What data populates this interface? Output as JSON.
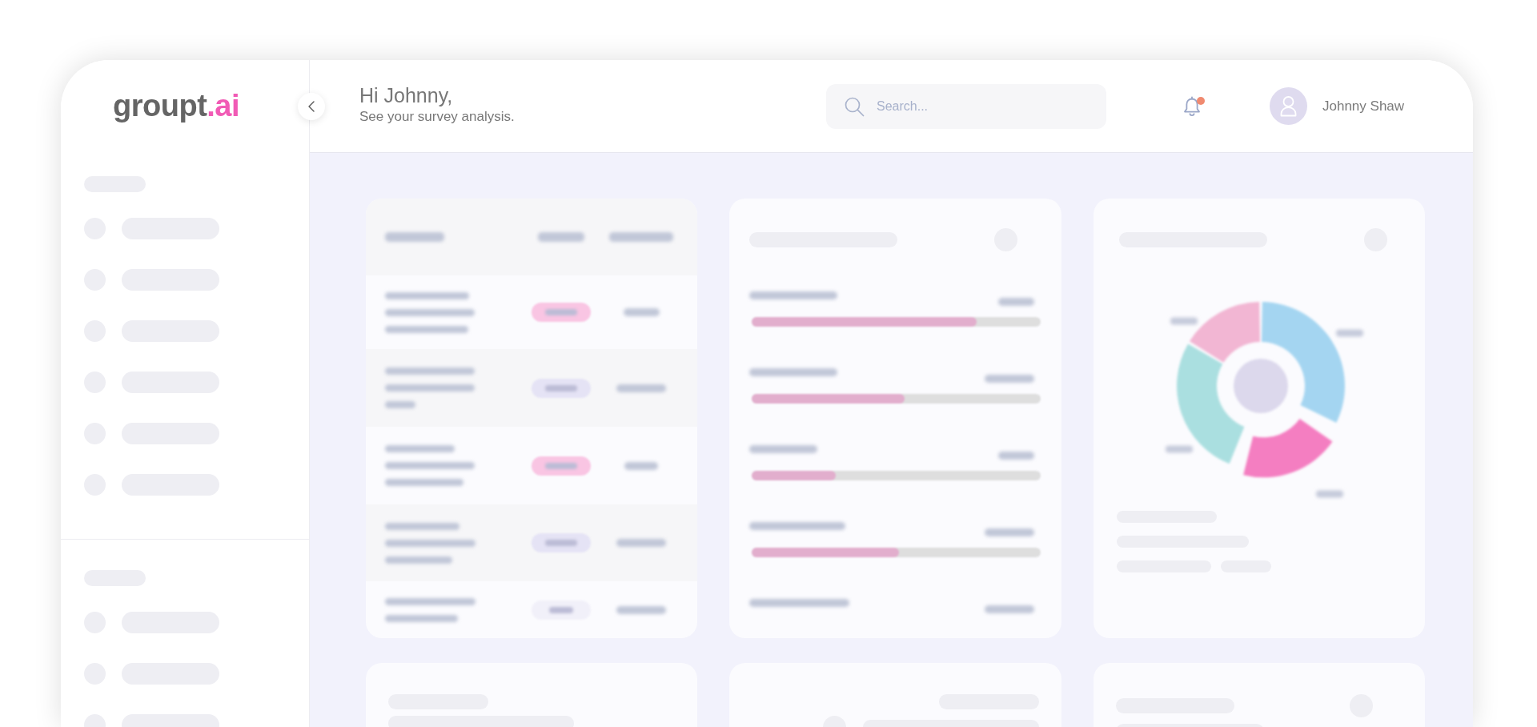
{
  "logo": {
    "name": "groupt",
    "accent": ".ai"
  },
  "header": {
    "greeting": "Hi Johnny,",
    "subtitle": "See your survey analysis.",
    "search": {
      "placeholder": "Search..."
    },
    "notifications": {
      "unread": true
    },
    "user": {
      "name": "Johnny Shaw"
    }
  },
  "sidebar": {
    "sections": [
      {
        "heading": {
          "kind": "placeholder"
        },
        "items": [
          {
            "kind": "placeholder"
          },
          {
            "kind": "placeholder"
          },
          {
            "kind": "placeholder"
          },
          {
            "kind": "placeholder"
          },
          {
            "kind": "placeholder"
          },
          {
            "kind": "placeholder"
          }
        ]
      },
      {
        "heading": {
          "kind": "placeholder"
        },
        "items": [
          {
            "kind": "placeholder"
          },
          {
            "kind": "placeholder"
          },
          {
            "kind": "placeholder"
          }
        ]
      }
    ]
  },
  "table_card": {
    "columns": [
      {
        "kind": "blurred"
      },
      {
        "kind": "blurred"
      },
      {
        "kind": "blurred"
      }
    ],
    "rows": [
      {
        "content": {
          "kind": "blurred"
        },
        "status": {
          "color": "#f9c5e3",
          "label": {
            "kind": "blurred"
          }
        },
        "category": {
          "kind": "blurred"
        }
      },
      {
        "content": {
          "kind": "blurred"
        },
        "status": {
          "color": "#e5e3f5",
          "label": {
            "kind": "blurred"
          }
        },
        "category": {
          "kind": "blurred"
        }
      },
      {
        "content": {
          "kind": "blurred"
        },
        "status": {
          "color": "#f9c5e3",
          "label": {
            "kind": "blurred"
          }
        },
        "category": {
          "kind": "blurred"
        }
      },
      {
        "content": {
          "kind": "blurred"
        },
        "status": {
          "color": "#e5e3f5",
          "label": {
            "kind": "blurred"
          }
        },
        "category": {
          "kind": "blurred"
        }
      },
      {
        "content": {
          "kind": "blurred"
        },
        "status": {
          "color": "#f1f0f9",
          "label": {
            "kind": "blurred"
          }
        },
        "category": {
          "kind": "blurred"
        }
      }
    ]
  },
  "meter_card": {
    "title": {
      "kind": "placeholder"
    },
    "action": {
      "kind": "placeholder"
    },
    "rows": [
      {
        "label": {
          "kind": "blurred"
        },
        "value": {
          "kind": "blurred"
        },
        "level": 0.78
      },
      {
        "label": {
          "kind": "blurred"
        },
        "value": {
          "kind": "blurred"
        },
        "level": 0.53
      },
      {
        "label": {
          "kind": "blurred"
        },
        "value": {
          "kind": "blurred"
        },
        "level": 0.29
      },
      {
        "label": {
          "kind": "blurred"
        },
        "value": {
          "kind": "blurred"
        },
        "level": 0.51
      },
      {
        "label": {
          "kind": "blurred"
        },
        "value": {
          "kind": "blurred"
        }
      }
    ]
  },
  "donut_card": {
    "title": {
      "kind": "placeholder"
    },
    "action": {
      "kind": "placeholder"
    },
    "segments": [
      {
        "color": "#a4d5f1",
        "label": {
          "kind": "blurred"
        }
      },
      {
        "color": "#f47ec1",
        "label": {
          "kind": "blurred"
        }
      },
      {
        "color": "#aadfe0",
        "label": {
          "kind": "blurred"
        }
      },
      {
        "color": "#f2b6d3",
        "label": {
          "kind": "blurred"
        }
      }
    ],
    "lines": [
      [
        {
          "kind": "placeholder"
        }
      ],
      [
        {
          "kind": "placeholder"
        }
      ],
      [
        {
          "kind": "placeholder"
        },
        {
          "kind": "placeholder"
        }
      ]
    ]
  },
  "bottom_cards": [
    {
      "title": {
        "kind": "placeholder"
      },
      "subtitle": {
        "kind": "placeholder"
      }
    },
    {
      "title": {
        "kind": "placeholder"
      },
      "action": {
        "kind": "placeholder"
      },
      "subtitle": {
        "kind": "placeholder"
      }
    },
    {
      "title": {
        "kind": "placeholder"
      },
      "action": {
        "kind": "placeholder"
      },
      "subtitle": {
        "kind": "placeholder"
      }
    }
  ]
}
